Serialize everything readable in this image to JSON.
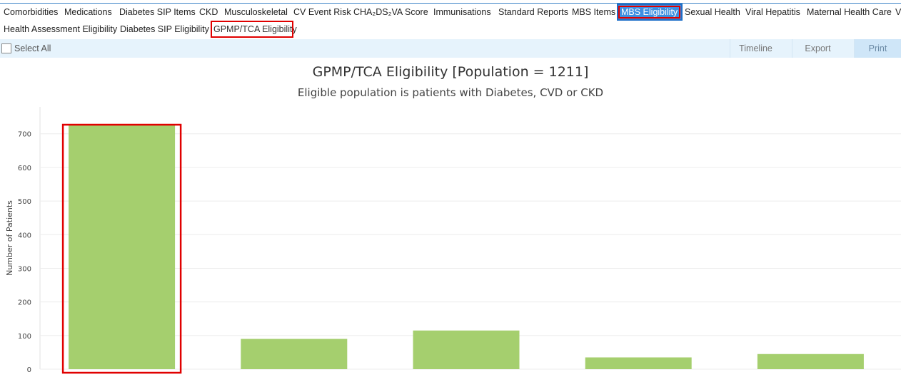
{
  "tabs_row1": [
    {
      "label": "Comorbidities",
      "x": 3,
      "w": 82
    },
    {
      "label": "Medications",
      "x": 88,
      "w": 73
    },
    {
      "label": "Diabetes SIP Items",
      "x": 165,
      "w": 107
    },
    {
      "label": "CKD",
      "x": 277,
      "w": 30
    },
    {
      "label": "Musculoskeletal",
      "x": 312,
      "w": 92
    },
    {
      "label": "CV Event Risk",
      "x": 409,
      "w": 80
    },
    {
      "label": "CHA₂DS₂VA Score",
      "x": 493,
      "w": 108
    },
    {
      "label": "Immunisations",
      "x": 605,
      "w": 85
    },
    {
      "label": "Standard Reports",
      "x": 696,
      "w": 98
    },
    {
      "label": "MBS Items",
      "x": 799,
      "w": 62
    },
    {
      "label": "MBS Eligibility",
      "x": 866,
      "w": 88,
      "state": "selected-blue"
    },
    {
      "label": "Sexual Health",
      "x": 957,
      "w": 80
    },
    {
      "label": "Viral Hepatitis",
      "x": 1042,
      "w": 81
    },
    {
      "label": "Maternal Health Care",
      "x": 1128,
      "w": 118
    },
    {
      "label": "V",
      "x": 1252,
      "w": 12
    }
  ],
  "tabs_row2": [
    {
      "label": "Health Assessment Eligibility",
      "x": 3,
      "w": 158
    },
    {
      "label": "Diabetes SIP Eligibility",
      "x": 166,
      "w": 125
    },
    {
      "label": "GPMP/TCA Eligibility",
      "x": 297,
      "w": 112,
      "state": "selected-red"
    }
  ],
  "toolbar": {
    "select_all": "Select All",
    "timeline": "Timeline",
    "export": "Export",
    "print": "Print"
  },
  "chart_data": {
    "type": "bar",
    "title": "GPMP/TCA Eligibility [Population = 1211]",
    "subtitle": "Eligible population is patients with Diabetes, CVD or CKD",
    "ylabel": "Number of Patients",
    "xlabel": "",
    "categories": [
      "",
      "",
      "",
      "",
      ""
    ],
    "values": [
      725,
      90,
      115,
      35,
      45
    ],
    "ylim": [
      0,
      780
    ],
    "yticks": [
      0,
      100,
      200,
      300,
      400,
      500,
      600,
      700
    ],
    "bar_color": "#a5cf6e",
    "highlight_color": "#e00000",
    "highlighted_index": 0,
    "grid": true
  }
}
